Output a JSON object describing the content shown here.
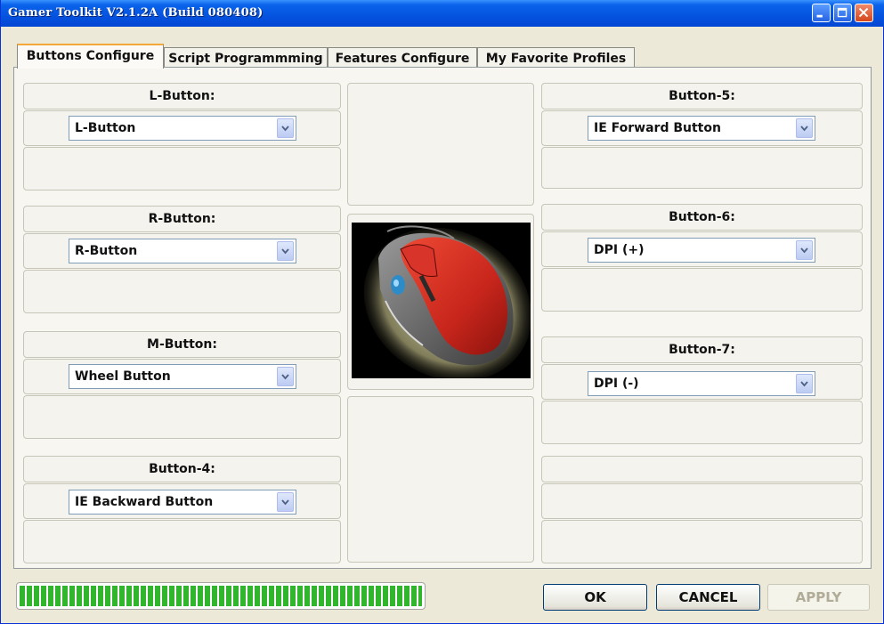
{
  "window": {
    "title": "Gamer Toolkit V2.1.2A (Build 080408)"
  },
  "tabs": [
    {
      "label": "Buttons Configure",
      "active": true
    },
    {
      "label": "Script Programmming",
      "active": false
    },
    {
      "label": "Features Configure",
      "active": false
    },
    {
      "label": "My Favorite Profiles",
      "active": false
    }
  ],
  "left_column": [
    {
      "label": "L-Button:",
      "value": "L-Button"
    },
    {
      "label": "R-Button:",
      "value": "R-Button"
    },
    {
      "label": "M-Button:",
      "value": "Wheel Button"
    },
    {
      "label": "Button-4:",
      "value": "IE Backward Button"
    }
  ],
  "right_column": [
    {
      "label": "Button-5:",
      "value": "IE Forward Button"
    },
    {
      "label": "Button-6:",
      "value": "DPI (+)"
    },
    {
      "label": "Button-7:",
      "value": "DPI (-)"
    }
  ],
  "footer": {
    "progress_fraction": 1.0,
    "ok_label": "OK",
    "cancel_label": "CANCEL",
    "apply_label": "APPLY"
  },
  "colors": {
    "titlebar": "#0553e0",
    "progress": "#30b52c",
    "mouse_body": "#c8261c"
  },
  "icons": {
    "minimize": "minimize-icon",
    "maximize": "maximize-icon",
    "close": "close-icon",
    "dropdown": "chevron-down-icon"
  }
}
